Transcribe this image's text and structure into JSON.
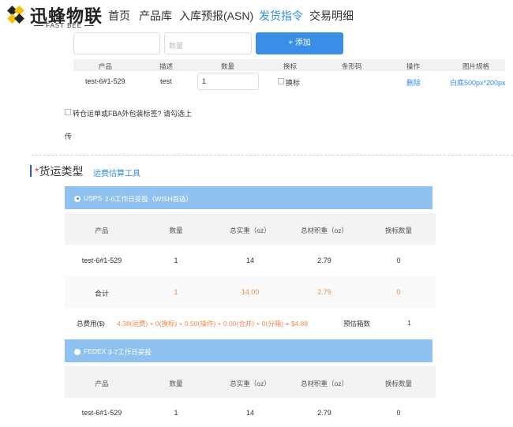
{
  "header": {
    "logo_cn": "迅蜂物联",
    "logo_en": "FAST BEE",
    "nav": [
      "首页",
      "产品库",
      "入库预报(ASN)",
      "发货指令",
      "交易明细"
    ],
    "active_nav": "发货指令"
  },
  "form": {
    "product_value": "",
    "qty_placeholder": "数量",
    "add_label": "+ 添加"
  },
  "product_table": {
    "headers": [
      "产品",
      "描述",
      "数量",
      "换标",
      "条形码",
      "操作",
      "图片规格"
    ],
    "row": {
      "product": "test-6#1-529",
      "desc": "test",
      "qty": "1",
      "relabel_label": "换标",
      "barcode": "",
      "action": "删除",
      "image_spec": "白底500px*200px"
    }
  },
  "transfer_note": {
    "label": "转仓运单或FBA外包装标签? 请勾选上",
    "label2": "传"
  },
  "shipping": {
    "title_star": "*",
    "title": "货运类型",
    "estimate_link": "运费估算工具",
    "carriers": [
      {
        "name": "USPS",
        "desc": "2-6工作日妥投（WISH首选）",
        "selected": true,
        "headers": [
          "产品",
          "数量",
          "总实重（oz）",
          "总材积重（oz）",
          "换标数量"
        ],
        "rows": [
          [
            "test-6#1-529",
            "1",
            "14",
            "2.79",
            "0"
          ]
        ],
        "total": [
          "合计",
          "1",
          "14.00",
          "2.79",
          "0"
        ],
        "fee_label": "总费用($)",
        "fee_formula": "4.38(运费) + 0(换标) + 0.50(操作) + 0.00(合并) + 0(分箱) = $4.88",
        "box_label": "预估箱数",
        "box_value": "1"
      },
      {
        "name": "FEDEX",
        "desc": "3-7工作日妥投",
        "selected": false,
        "headers": [
          "产品",
          "数量",
          "总实重（oz）",
          "总材积重（oz）",
          "换标数量"
        ],
        "rows": [
          [
            "test-6#1-529",
            "1",
            "14",
            "2.79",
            "0"
          ]
        ]
      }
    ]
  },
  "colors": {
    "accent": "#2f8de4",
    "button": "#3a8ee6",
    "carrier_bar": "#8fc2f1",
    "highlight": "#f08a4b",
    "required": "#e54545"
  }
}
